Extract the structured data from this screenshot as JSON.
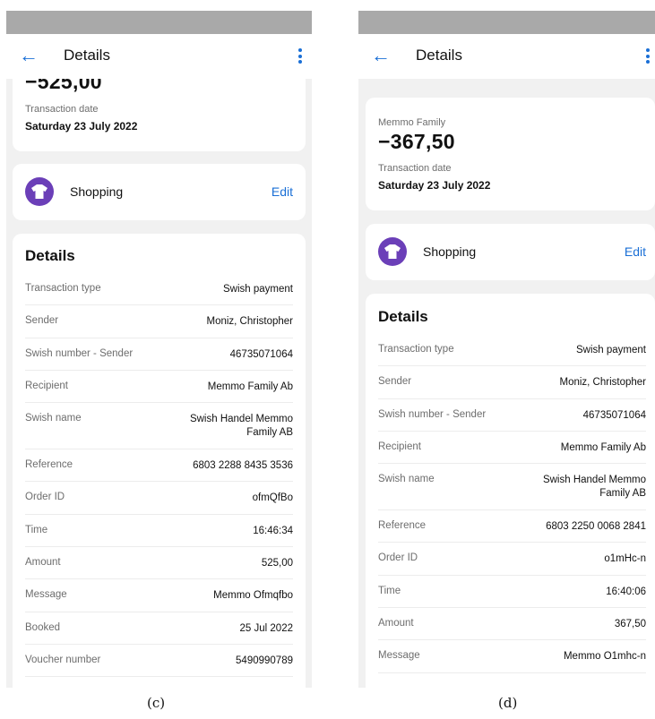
{
  "phone_c": {
    "header": {
      "title": "Details"
    },
    "summary": {
      "amount": "−525,00",
      "date_label": "Transaction date",
      "date": "Saturday 23 July 2022"
    },
    "category": {
      "label": "Shopping",
      "edit_label": "Edit"
    },
    "details_title": "Details",
    "rows": [
      {
        "key": "Transaction type",
        "value": "Swish payment"
      },
      {
        "key": "Sender",
        "value": "Moniz, Christopher"
      },
      {
        "key": "Swish number - Sender",
        "value": "46735071064"
      },
      {
        "key": "Recipient",
        "value": "Memmo Family Ab"
      },
      {
        "key": "Swish name",
        "value": "Swish Handel Memmo Family AB"
      },
      {
        "key": "Reference",
        "value": "6803 2288 8435 3536"
      },
      {
        "key": "Order ID",
        "value": "ofmQfBo"
      },
      {
        "key": "Time",
        "value": "16:46:34"
      },
      {
        "key": "Amount",
        "value": "525,00"
      },
      {
        "key": "Message",
        "value": "Memmo Ofmqfbo"
      },
      {
        "key": "Booked",
        "value": "25 Jul 2022"
      },
      {
        "key": "Voucher number",
        "value": "5490990789"
      }
    ],
    "caption": "(c)"
  },
  "phone_d": {
    "header": {
      "title": "Details"
    },
    "summary": {
      "merchant": "Memmo Family",
      "amount": "−367,50",
      "date_label": "Transaction date",
      "date": "Saturday 23 July 2022"
    },
    "category": {
      "label": "Shopping",
      "edit_label": "Edit"
    },
    "details_title": "Details",
    "rows": [
      {
        "key": "Transaction type",
        "value": "Swish payment"
      },
      {
        "key": "Sender",
        "value": "Moniz, Christopher"
      },
      {
        "key": "Swish number - Sender",
        "value": "46735071064"
      },
      {
        "key": "Recipient",
        "value": "Memmo Family Ab"
      },
      {
        "key": "Swish name",
        "value": "Swish Handel Memmo Family AB"
      },
      {
        "key": "Reference",
        "value": "6803 2250 0068 2841"
      },
      {
        "key": "Order ID",
        "value": "o1mHc-n"
      },
      {
        "key": "Time",
        "value": "16:40:06"
      },
      {
        "key": "Amount",
        "value": "367,50"
      },
      {
        "key": "Message",
        "value": "Memmo O1mhc-n"
      }
    ],
    "caption": "(d)"
  },
  "colors": {
    "accent": "#1a6fd6",
    "category_icon": "#6b3fb8",
    "status_bar": "#a9a9a9",
    "background": "#f1f1f1"
  },
  "icons": {
    "back": "arrow-left-icon",
    "menu": "more-vertical-icon",
    "category": "tshirt-icon"
  }
}
